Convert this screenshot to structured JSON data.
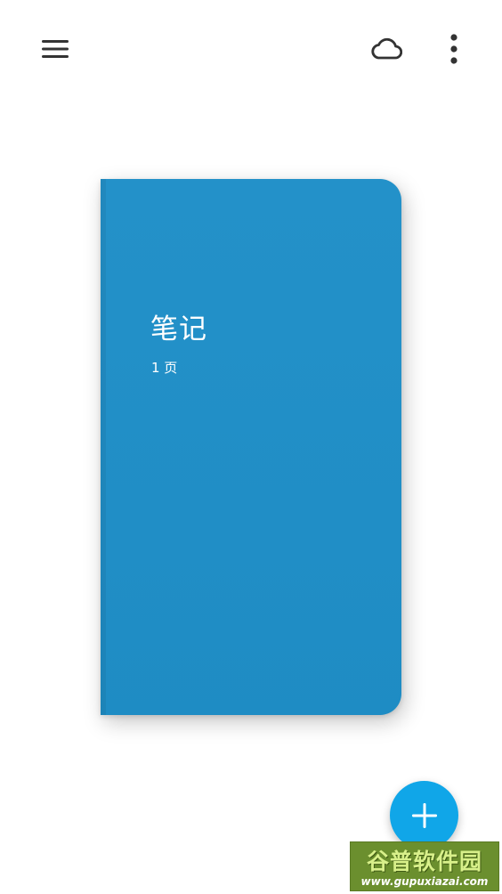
{
  "topbar": {
    "icons": {
      "menu": "menu-icon",
      "sync": "cloud-icon",
      "more": "more-vertical-icon"
    }
  },
  "notebook": {
    "title": "笔记",
    "pages": "1 页",
    "color": "#1f8fc8"
  },
  "fab": {
    "icon": "plus-icon",
    "color": "#10a6e8"
  },
  "watermark": {
    "logo": "谷普软件园",
    "url": "www.gupuxiazai.com"
  }
}
